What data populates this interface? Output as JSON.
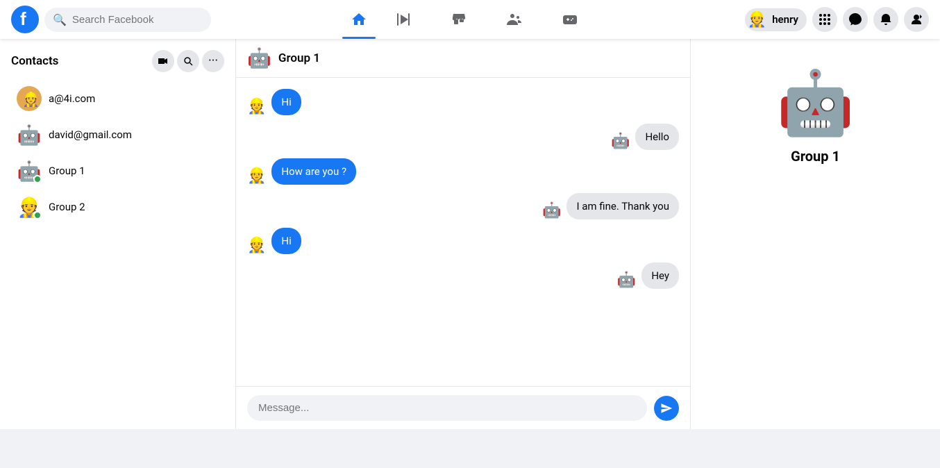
{
  "app": {
    "title": "Facebook"
  },
  "topnav": {
    "search_placeholder": "Search Facebook",
    "logo_emoji": "🔵",
    "nav_items": [
      {
        "id": "home",
        "label": "Home",
        "active": true,
        "icon": "🏠"
      },
      {
        "id": "video",
        "label": "Watch",
        "active": false,
        "icon": "▶"
      },
      {
        "id": "marketplace",
        "label": "Marketplace",
        "active": false,
        "icon": "🏪"
      },
      {
        "id": "groups",
        "label": "Groups",
        "active": false,
        "icon": "👥"
      },
      {
        "id": "gaming",
        "label": "Gaming",
        "active": false,
        "icon": "🎮"
      }
    ],
    "user_name": "henry",
    "user_avatar": "👷",
    "right_icons": [
      {
        "id": "grid",
        "icon": "⋮⋮"
      },
      {
        "id": "messenger",
        "icon": "💬"
      },
      {
        "id": "notifications",
        "icon": "🔔"
      },
      {
        "id": "menu",
        "icon": "↪"
      }
    ]
  },
  "sidebar": {
    "contacts_title": "Contacts",
    "contacts": [
      {
        "id": 1,
        "name": "a@4i.com",
        "avatar": "👷",
        "online": false
      },
      {
        "id": 2,
        "name": "david@gmail.com",
        "avatar": "🤖",
        "online": false
      },
      {
        "id": 3,
        "name": "Group 1",
        "avatar": "🤖",
        "online": true
      },
      {
        "id": 4,
        "name": "Group 2",
        "avatar": "👷",
        "online": true
      }
    ]
  },
  "chat": {
    "group_name": "Group 1",
    "group_avatar": "🤖",
    "messages": [
      {
        "id": 1,
        "text": "Hi",
        "sender": "left",
        "avatar": "👷"
      },
      {
        "id": 2,
        "text": "Hello",
        "sender": "right",
        "avatar": "🤖"
      },
      {
        "id": 3,
        "text": "How are you ?",
        "sender": "left",
        "avatar": "👷"
      },
      {
        "id": 4,
        "text": "I am fine. Thank you",
        "sender": "right",
        "avatar": "🤖"
      },
      {
        "id": 5,
        "text": "Hi",
        "sender": "left",
        "avatar": "👷"
      },
      {
        "id": 6,
        "text": "Hey",
        "sender": "right",
        "avatar": "🤖"
      }
    ],
    "input_placeholder": "Message..."
  },
  "right_sidebar": {
    "group_name": "Group 1",
    "group_avatar": "🤖"
  }
}
